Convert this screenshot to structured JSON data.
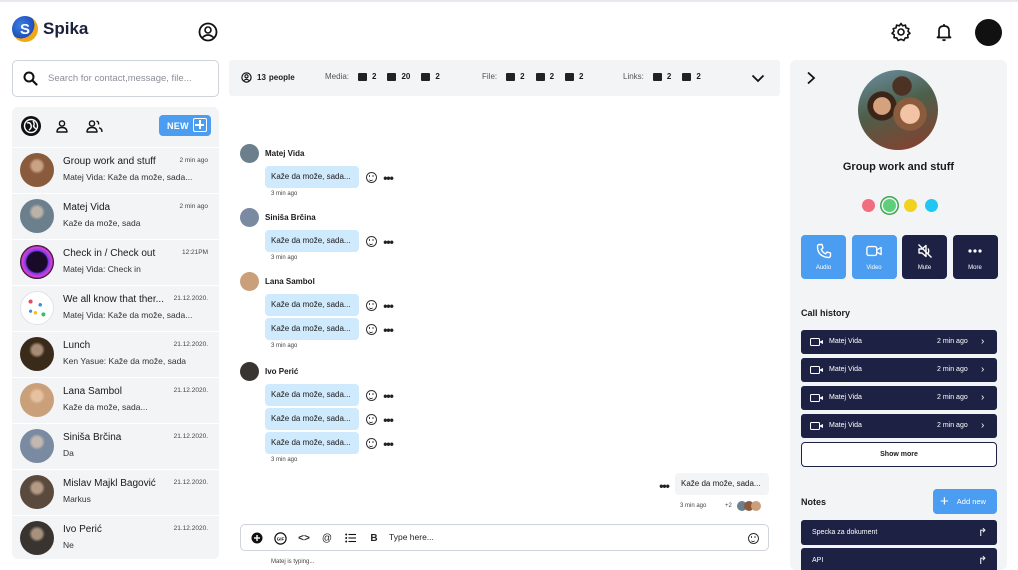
{
  "app": {
    "name": "Spika",
    "logo_letter": "S"
  },
  "header": {
    "profile_icon": "user-circle-icon",
    "settings_icon": "gear-icon",
    "notifications_icon": "bell-icon"
  },
  "search": {
    "placeholder": "Search for contact,message, file..."
  },
  "chatlist": {
    "new_label": "NEW",
    "items": [
      {
        "name": "Group work and stuff",
        "time": "2 min ago",
        "preview": "Matej Vida: Kaže da može, sada...",
        "avatar_color": "#8a5a3c"
      },
      {
        "name": "Matej Vida",
        "time": "2 min ago",
        "preview": "Kaže da može, sada",
        "avatar_color": "#6b7f8c"
      },
      {
        "name": "Check in / Check out",
        "time": "12:21PM",
        "preview": "Matej Vida: Check in",
        "avatar_color": "#2a1a4a"
      },
      {
        "name": "We all know that ther...",
        "time": "21.12.2020.",
        "preview": "Matej Vida: Kaže da može, sada...",
        "avatar_color": "#ffffff"
      },
      {
        "name": "Lunch",
        "time": "21.12.2020.",
        "preview": "Ken Yasue: Kaže da može, sada",
        "avatar_color": "#3a2a1a"
      },
      {
        "name": "Lana Sambol",
        "time": "21.12.2020.",
        "preview": "Kaže da može, sada...",
        "avatar_color": "#c9a07a"
      },
      {
        "name": "Siniša Brčina",
        "time": "21.12.2020.",
        "preview": "Da",
        "avatar_color": "#7a8aa0"
      },
      {
        "name": "Mislav Majkl Bagović",
        "time": "21.12.2020.",
        "preview": "Markus",
        "avatar_color": "#5a4a3e"
      },
      {
        "name": "Ivo Perić",
        "time": "21.12.2020.",
        "preview": "Ne",
        "avatar_color": "#3a3430"
      }
    ]
  },
  "infobar": {
    "people_count": "13",
    "people_label": "people",
    "media_label": "Media:",
    "media": [
      "2",
      "20",
      "2"
    ],
    "file_label": "File:",
    "files": [
      "2",
      "2",
      "2"
    ],
    "links_label": "Links:",
    "links": [
      "2",
      "2"
    ]
  },
  "messages": {
    "bubble_text": "Kaže da može, sada...",
    "ago": "3 min ago",
    "groups": [
      {
        "author": "Matej Vida"
      },
      {
        "author": "Siniša Brčina"
      },
      {
        "author": "Lana Sambol"
      },
      {
        "author": "Ivo Perić"
      }
    ],
    "outgoing_text": "Kaže da može, sada...",
    "outgoing_ago": "3 min ago",
    "seen_extra": "+2"
  },
  "composer": {
    "placeholder": "Type here...",
    "typing": "Matej is typing..."
  },
  "panel": {
    "group_name": "Group work and stuff",
    "colors": [
      "#f26d7d",
      "#5ccf78",
      "#f2d21e",
      "#20c7f2"
    ],
    "actions": [
      {
        "label": "Audio",
        "icon": "phone-icon",
        "color": "#4a9df0"
      },
      {
        "label": "Video",
        "icon": "video-icon",
        "color": "#4a9df0"
      },
      {
        "label": "Mute",
        "icon": "mute-icon",
        "color": "#1d2244"
      },
      {
        "label": "More",
        "icon": "more-icon",
        "color": "#1d2244"
      }
    ],
    "call_history_title": "Call history",
    "calls": [
      {
        "name": "Matej Vida",
        "time": "2 min ago"
      },
      {
        "name": "Matej Vida",
        "time": "2 min ago"
      },
      {
        "name": "Matej Vida",
        "time": "2 min ago"
      },
      {
        "name": "Matej Vida",
        "time": "2 min ago"
      }
    ],
    "show_more": "Show more",
    "notes_title": "Notes",
    "add_new": "Add new",
    "notes": [
      {
        "name": "Specka za dokument"
      },
      {
        "name": "API"
      }
    ]
  }
}
